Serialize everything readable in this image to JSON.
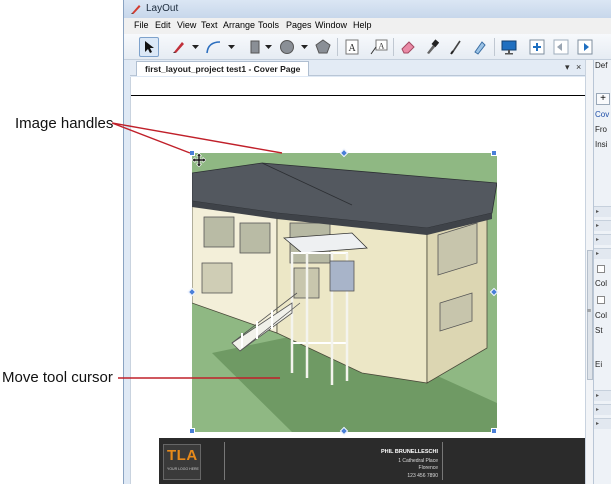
{
  "callouts": {
    "image_handles": "Image handles",
    "move_cursor": "Move tool cursor"
  },
  "window": {
    "title": "LayOut",
    "app_icon": "layout-pen-icon"
  },
  "menu": [
    "File",
    "Edit",
    "View",
    "Text",
    "Arrange",
    "Tools",
    "Pages",
    "Window",
    "Help"
  ],
  "toolbar": {
    "tools": [
      "select-arrow-icon",
      "pencil-icon",
      "arc-icon",
      "rectangle-icon",
      "circle-icon",
      "polygon-icon",
      "text-icon",
      "label-icon",
      "eraser-icon",
      "eyedropper-icon",
      "split-icon",
      "join-icon",
      "presentation-icon",
      "add-page-icon",
      "previous-page-icon",
      "next-page-icon"
    ]
  },
  "document": {
    "tab_label": "first_layout_project test1 - Cover Page",
    "tab_pin": "▾",
    "tab_close": "×"
  },
  "titleblock": {
    "logo": "TLA",
    "logo_sub": "YOUR LOGO HERE",
    "name": "PHIL BRUNELLESCHI",
    "address": [
      "1 Cathedral Place",
      "Florence",
      "123 456 7890"
    ]
  },
  "tray": {
    "header": "Def",
    "add_label": "+",
    "items": [
      "Cov",
      "Fro",
      "Insi"
    ],
    "labels": [
      "Col",
      "Col",
      "St",
      "Ei"
    ]
  },
  "colors": {
    "accent": "#e88a1a",
    "handle": "#4a7fd8",
    "callout_line": "#c0202a",
    "grass": "#8fb883"
  }
}
